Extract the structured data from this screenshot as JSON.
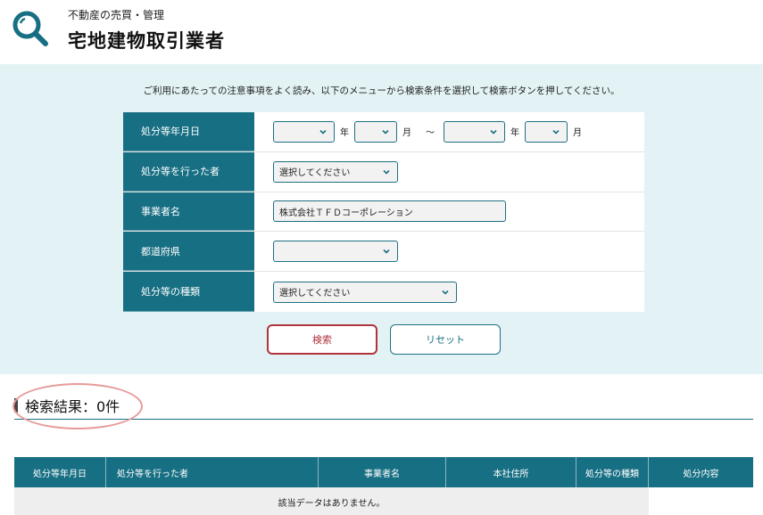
{
  "header": {
    "subtitle": "不動産の売買・管理",
    "title": "宅地建物取引業者",
    "icon": "magnifier-icon"
  },
  "notice": "ご利用にあたっての注意事項をよく読み、以下のメニューから検索条件を選択して検索ボタンを押してください。",
  "form": {
    "date_label": "処分等年月日",
    "year_unit": "年",
    "month_unit": "月",
    "range_sep": "～",
    "from_year": "",
    "from_month": "",
    "to_year": "",
    "to_month": "",
    "actor_label": "処分等を行った者",
    "actor_value": "選択してください",
    "company_label": "事業者名",
    "company_value": "株式会社ＴＦＤコーポレーション",
    "prefecture_label": "都道府県",
    "prefecture_value": "",
    "type_label": "処分等の種類",
    "type_value": "選択してください"
  },
  "buttons": {
    "search": "検索",
    "reset": "リセット"
  },
  "result": {
    "heading": "検索結果：0件",
    "columns": [
      "処分等年月日",
      "処分等を行った者",
      "事業者名",
      "本社住所",
      "処分等の種類",
      "処分内容"
    ],
    "empty_message": "該当データはありません。"
  },
  "colors": {
    "teal": "#176f83",
    "search_bg": "#e3f3f5",
    "search_button": "#b0333d",
    "highlight": "#e79a9a"
  }
}
